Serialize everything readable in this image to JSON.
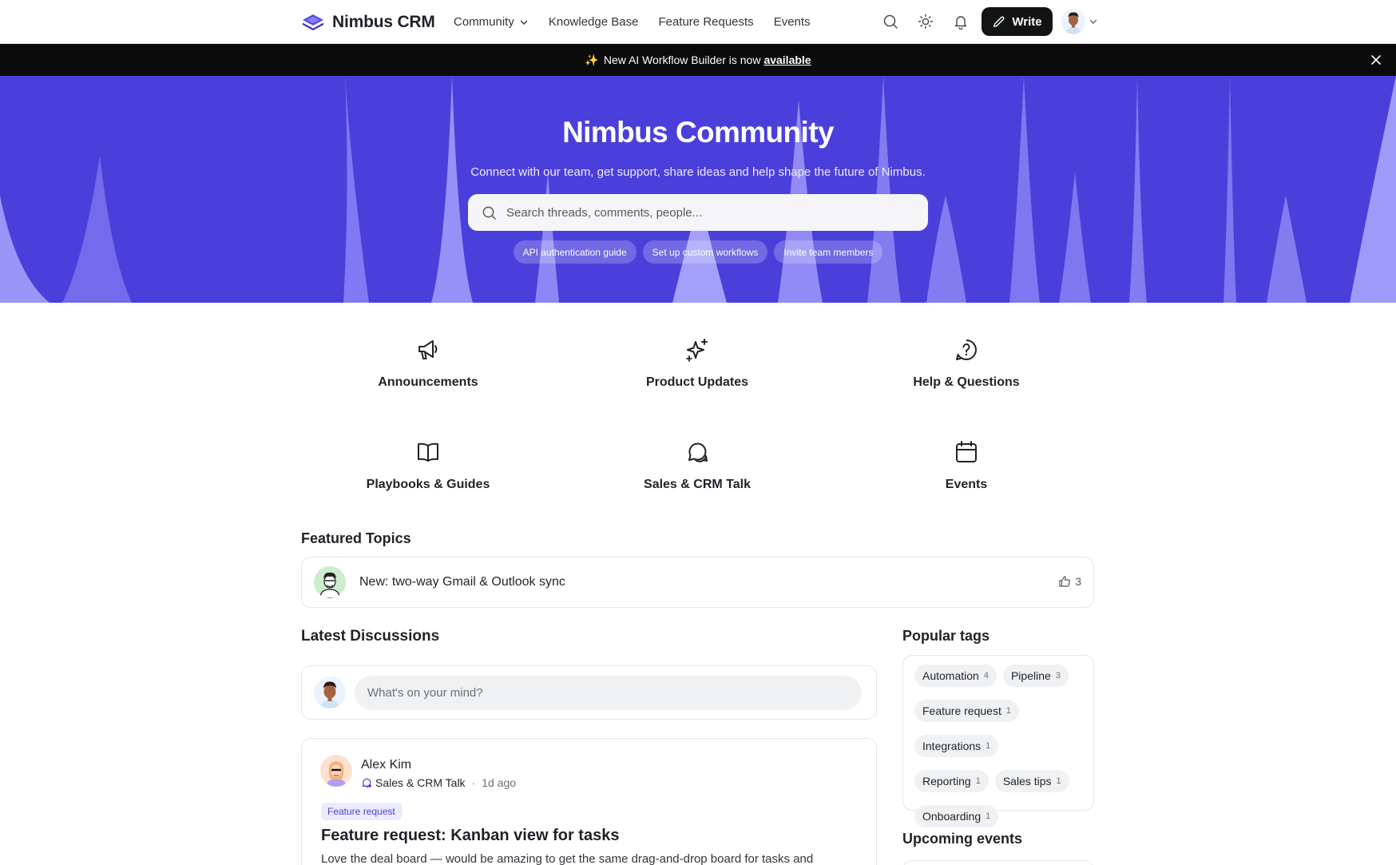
{
  "nav": {
    "brand": "Nimbus CRM",
    "links": [
      {
        "label": "Community",
        "has_dropdown": true
      },
      {
        "label": "Knowledge Base"
      },
      {
        "label": "Feature Requests"
      },
      {
        "label": "Events"
      }
    ],
    "write_label": "Write"
  },
  "announcement": {
    "text": "New AI Workflow Builder is now",
    "link": "available"
  },
  "hero": {
    "title": "Nimbus Community",
    "subtitle": "Connect with our team, get support, share ideas and help shape the future of Nimbus.",
    "search_placeholder": "Search threads, comments, people...",
    "chips": [
      "API authentication guide",
      "Set up custom workflows",
      "Invite team members"
    ]
  },
  "categories": [
    {
      "label": "Announcements",
      "icon": "megaphone-icon"
    },
    {
      "label": "Product Updates",
      "icon": "sparkles-icon"
    },
    {
      "label": "Help & Questions",
      "icon": "help-circle-icon"
    },
    {
      "label": "Playbooks & Guides",
      "icon": "book-icon"
    },
    {
      "label": "Sales & CRM Talk",
      "icon": "chat-icon"
    },
    {
      "label": "Events",
      "icon": "calendar-icon"
    }
  ],
  "featured": {
    "heading": "Featured Topics",
    "items": [
      {
        "title": "New: two-way Gmail & Outlook sync",
        "likes": "3"
      }
    ]
  },
  "discussions": {
    "heading": "Latest Discussions",
    "composer_placeholder": "What's on your mind?",
    "posts": [
      {
        "author": "Alex Kim",
        "category": "Sales & CRM Talk",
        "time": "1d ago",
        "tag": "Feature request",
        "title": "Feature request: Kanban view for tasks",
        "excerpt": "Love the deal board — would be amazing to get the same drag-and-drop board for tasks and"
      }
    ]
  },
  "sidebar": {
    "tags_heading": "Popular tags",
    "tags": [
      {
        "name": "Automation",
        "count": "4"
      },
      {
        "name": "Pipeline",
        "count": "3"
      },
      {
        "name": "Feature request",
        "count": "1"
      },
      {
        "name": "Integrations",
        "count": "1"
      },
      {
        "name": "Reporting",
        "count": "1"
      },
      {
        "name": "Sales tips",
        "count": "1"
      },
      {
        "name": "Onboarding",
        "count": "1"
      }
    ],
    "events_heading": "Upcoming events"
  },
  "colors": {
    "accent": "#4b3fdb",
    "announcement_bg": "#0b0b0c",
    "write_button_bg": "#111315"
  }
}
